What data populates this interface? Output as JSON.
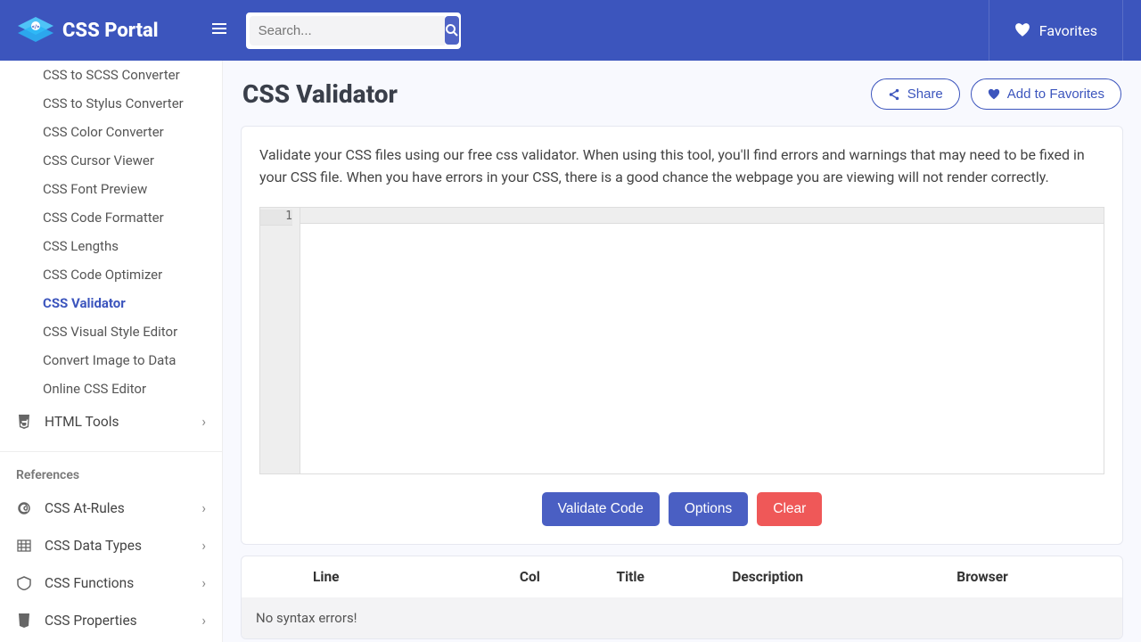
{
  "header": {
    "brand": "CSS Portal",
    "search_placeholder": "Search...",
    "favorites_label": "Favorites"
  },
  "sidebar": {
    "sub_items": [
      "CSS to SCSS Converter",
      "CSS to Stylus Converter",
      "CSS Color Converter",
      "CSS Cursor Viewer",
      "CSS Font Preview",
      "CSS Code Formatter",
      "CSS Lengths",
      "CSS Code Optimizer",
      "CSS Validator",
      "CSS Visual Style Editor",
      "Convert Image to Data",
      "Online CSS Editor"
    ],
    "active_sub": "CSS Validator",
    "tools_item": "HTML Tools",
    "references_label": "References",
    "ref_items": [
      "CSS At-Rules",
      "CSS Data Types",
      "CSS Functions",
      "CSS Properties"
    ]
  },
  "page": {
    "title": "CSS Validator",
    "share_label": "Share",
    "add_fav_label": "Add to Favorites",
    "description": "Validate your CSS files using our free css validator. When using this tool, you'll find errors and warnings that may need to be fixed in your CSS file. When you have errors in your CSS, there is a good chance the webpage you are viewing will not render correctly.",
    "line_number": "1",
    "buttons": {
      "validate": "Validate Code",
      "options": "Options",
      "clear": "Clear"
    },
    "table": {
      "headers": [
        "Line",
        "Col",
        "Title",
        "Description",
        "Browser"
      ],
      "empty_msg": "No syntax errors!"
    }
  }
}
